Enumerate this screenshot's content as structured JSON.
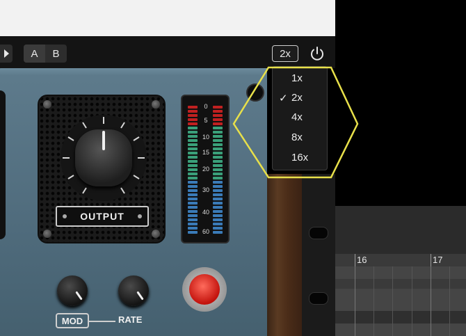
{
  "header": {
    "play_icon": "play-arrow-icon",
    "ab_toggle": {
      "a_label": "A",
      "b_label": "B"
    },
    "oversample_button": "2x",
    "power_icon": "power-icon"
  },
  "oversample_menu": {
    "items": [
      {
        "label": "1x",
        "checked": false
      },
      {
        "label": "2x",
        "checked": true
      },
      {
        "label": "4x",
        "checked": false
      },
      {
        "label": "8x",
        "checked": false
      },
      {
        "label": "16x",
        "checked": false
      }
    ],
    "check_glyph": "✓",
    "highlight_color": "#e8e04a"
  },
  "plugin": {
    "output_label": "OUTPUT",
    "meter_labels": [
      "0",
      "5",
      "10",
      "15",
      "20",
      "30",
      "40",
      "60"
    ],
    "mod_label": "MOD",
    "rate_label": "RATE",
    "colors": {
      "panel": "#5e7b8c",
      "button_red": "#e0241b"
    }
  },
  "timeline": {
    "bar_numbers": [
      "16",
      "17"
    ]
  }
}
